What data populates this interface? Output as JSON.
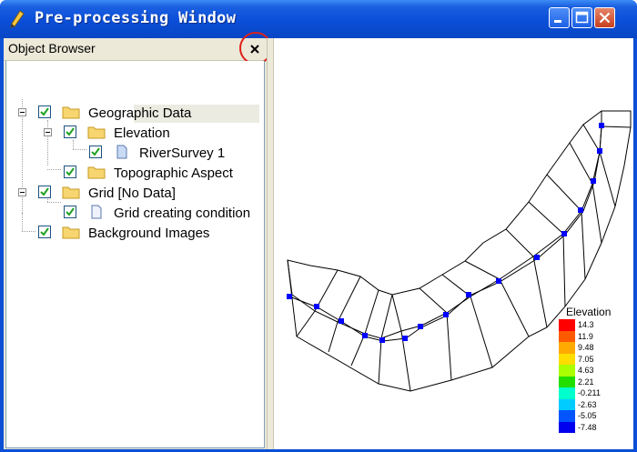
{
  "window": {
    "title": "Pre-processing Window",
    "icon": "pencil-icon",
    "controls": [
      "minimize-icon",
      "maximize-icon",
      "close-icon"
    ]
  },
  "object_browser": {
    "title": "Object Browser",
    "close_icon": "close-icon",
    "tree": [
      {
        "label": "Geographic Data",
        "checked": true,
        "icon": "folder-icon",
        "expanded": true
      },
      {
        "label": "Elevation",
        "checked": true,
        "icon": "folder-icon",
        "expanded": true
      },
      {
        "label": "RiverSurvey 1",
        "checked": true,
        "icon": "document-icon",
        "selected": true
      },
      {
        "label": "Topographic Aspect",
        "checked": true,
        "icon": "folder-icon"
      },
      {
        "label": "Grid [No Data]",
        "checked": true,
        "icon": "folder-icon",
        "expanded": true
      },
      {
        "label": "Grid creating condition",
        "checked": true,
        "icon": "document-icon"
      },
      {
        "label": "Background Images",
        "checked": true,
        "icon": "folder-icon"
      }
    ]
  },
  "legend": {
    "title": "Elevation",
    "values": [
      "14.3",
      "11.9",
      "9.48",
      "7.05",
      "4.63",
      "2.21",
      "-0.211",
      "-2.63",
      "-5.05",
      "-7.48"
    ],
    "colors": [
      "#ff0000",
      "#ff5a00",
      "#ffaa00",
      "#ffdd00",
      "#aaff00",
      "#22dd00",
      "#00ffcc",
      "#00ccff",
      "#0055ff",
      "#0000ee"
    ]
  },
  "accent": {
    "titlebar": "#0a4fd6",
    "highlight": "#e0201a",
    "point": "#0000ff"
  }
}
